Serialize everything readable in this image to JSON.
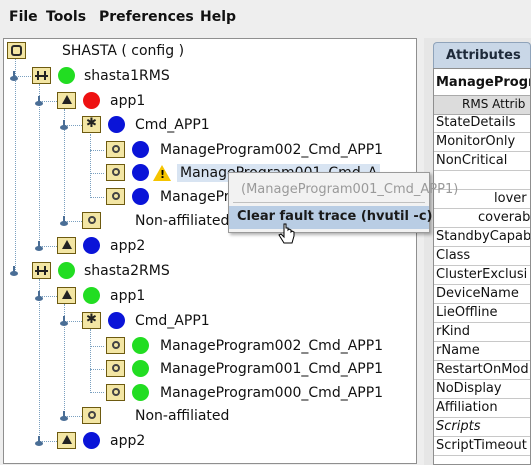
{
  "menu": [
    "File",
    "Tools",
    "Preferences",
    "Help"
  ],
  "tree": {
    "root": "SHASTA ( config )",
    "nodes": [
      {
        "name": "shasta1RMS",
        "status": "green",
        "apps": [
          {
            "name": "app1",
            "status": "red",
            "cmd": {
              "name": "Cmd_APP1",
              "status": "blue",
              "programs": [
                {
                  "name": "ManageProgram002_Cmd_APP1",
                  "status": "blue"
                },
                {
                  "name": "ManageProgram001_Cmd_A",
                  "status": "blue",
                  "warning": true,
                  "selected": true
                },
                {
                  "name": "ManagePro",
                  "status": "blue"
                }
              ]
            },
            "nonaffiliated": "Non-affiliated"
          },
          {
            "name": "app2",
            "status": "blue"
          }
        ]
      },
      {
        "name": "shasta2RMS",
        "status": "green",
        "apps": [
          {
            "name": "app1",
            "status": "green",
            "cmd": {
              "name": "Cmd_APP1",
              "status": "blue",
              "programs": [
                {
                  "name": "ManageProgram002_Cmd_APP1",
                  "status": "green"
                },
                {
                  "name": "ManageProgram001_Cmd_APP1",
                  "status": "green"
                },
                {
                  "name": "ManageProgram000_Cmd_APP1",
                  "status": "green"
                }
              ]
            },
            "nonaffiliated": "Non-affiliated"
          },
          {
            "name": "app2",
            "status": "blue"
          }
        ]
      }
    ]
  },
  "context_menu": {
    "header": "(ManageProgram001_Cmd_APP1)",
    "items": [
      "Clear fault trace (hvutil -c)"
    ]
  },
  "attributes_panel": {
    "tab": "Attributes",
    "title": "ManageProgra",
    "column_header": "RMS Attrib",
    "rows": [
      "StateDetails",
      "MonitorOnly",
      "NonCritical",
      "",
      "lover",
      "coverab",
      "StandbyCapab",
      "Class",
      "ClusterExclusi",
      "DeviceName",
      "LieOffline",
      "rKind",
      "rName",
      "RestartOnMod",
      "NoDisplay",
      "Affiliation",
      "Scripts",
      "ScriptTimeout"
    ]
  },
  "colors": {
    "green": "#22dd22",
    "blue": "#0a14d8",
    "red": "#ee1111",
    "selection": "#d8e4f2",
    "menu_highlight": "#b9cde4"
  }
}
